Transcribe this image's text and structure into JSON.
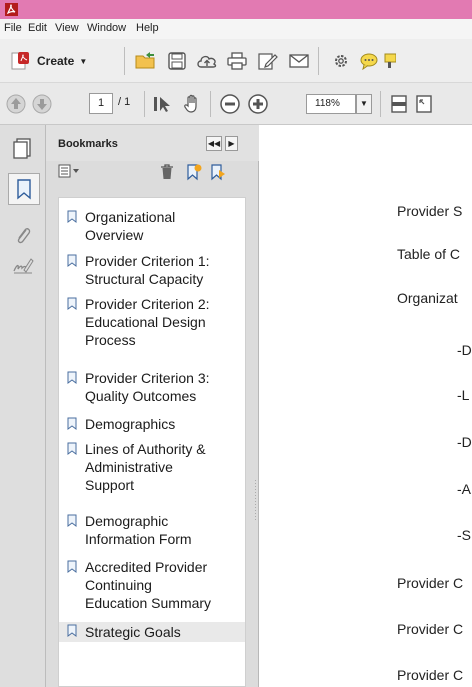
{
  "menu": [
    "File",
    "Edit",
    "View",
    "Window",
    "Help"
  ],
  "toolbar": {
    "create_label": "Create",
    "page_current": "1",
    "page_total": "/ 1",
    "zoom": "118%"
  },
  "bookmarks": {
    "title": "Bookmarks",
    "items": [
      {
        "label_lines": [
          "Organizational",
          "Overview"
        ]
      },
      {
        "label_lines": [
          "Provider Criterion 1:",
          "Structural Capacity"
        ]
      },
      {
        "label_lines": [
          "Provider Criterion 2:",
          "Educational Design",
          "Process"
        ]
      },
      {
        "label_lines": [
          "Provider Criterion 3:",
          "Quality Outcomes"
        ]
      },
      {
        "label_lines": [
          "Demographics"
        ]
      },
      {
        "label_lines": [
          "Lines of Authority &",
          "Administrative",
          "Support"
        ]
      },
      {
        "label_lines": [
          "Demographic",
          "Information Form"
        ]
      },
      {
        "label_lines": [
          "Accredited Provider",
          "Continuing",
          "Education Summary"
        ]
      },
      {
        "label_lines": [
          "Strategic Goals"
        ],
        "selected": true
      }
    ]
  },
  "document": {
    "lines": [
      "Provider S",
      "Table of C",
      "Organizat",
      "-D",
      "-L",
      "-D",
      "-A",
      "-S",
      "Provider C",
      "Provider C",
      "Provider C"
    ]
  },
  "colors": {
    "titlebar": "#e27ab2",
    "toolbar": "#eeeeee",
    "panel": "#dcdcdc"
  }
}
